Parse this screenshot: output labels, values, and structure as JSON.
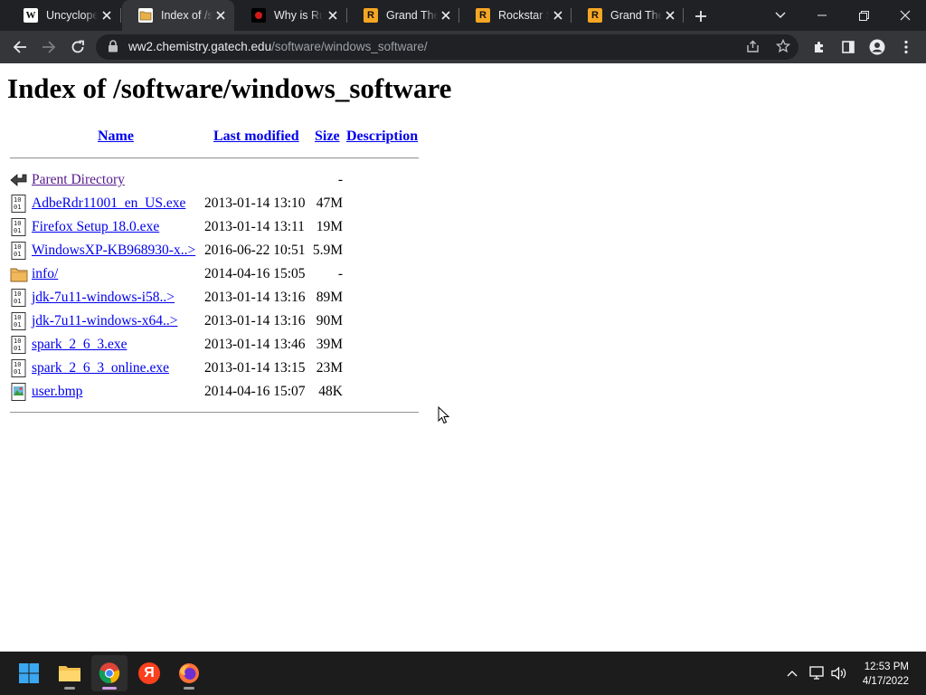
{
  "browser": {
    "tabs": [
      {
        "title": "Uncyclopedia",
        "favicon": "wikipedia-icon",
        "active": false
      },
      {
        "title": "Index of /software/windows_software",
        "favicon": "folder-icon",
        "active": true
      },
      {
        "title": "Why is Rust",
        "favicon": "video-icon",
        "active": false
      },
      {
        "title": "Grand Theft Auto",
        "favicon": "rockstar-icon",
        "active": false
      },
      {
        "title": "Rockstar Store",
        "favicon": "rockstar-icon",
        "active": false
      },
      {
        "title": "Grand Theft Auto",
        "favicon": "rockstar-icon",
        "active": false
      }
    ],
    "address": {
      "host": "ww2.chemistry.gatech.edu",
      "path": "/software/windows_software/"
    }
  },
  "page": {
    "title": "Index of /software/windows_software",
    "columns": {
      "name": "Name",
      "modified": "Last modified",
      "size": "Size",
      "description": "Description"
    },
    "entries": [
      {
        "name": "Parent Directory",
        "modified": "",
        "size": "-",
        "icon": "back-arrow-icon",
        "visited": true
      },
      {
        "name": "AdbeRdr11001_en_US.exe",
        "modified": "2013-01-14 13:10",
        "size": "47M",
        "icon": "binary-file-icon"
      },
      {
        "name": "Firefox Setup 18.0.exe",
        "modified": "2013-01-14 13:11",
        "size": "19M",
        "icon": "binary-file-icon"
      },
      {
        "name": "WindowsXP-KB968930-x..>",
        "modified": "2016-06-22 10:51",
        "size": "5.9M",
        "icon": "binary-file-icon"
      },
      {
        "name": "info/",
        "modified": "2014-04-16 15:05",
        "size": "-",
        "icon": "folder-icon"
      },
      {
        "name": "jdk-7u11-windows-i58..>",
        "modified": "2013-01-14 13:16",
        "size": "89M",
        "icon": "binary-file-icon"
      },
      {
        "name": "jdk-7u11-windows-x64..>",
        "modified": "2013-01-14 13:16",
        "size": "90M",
        "icon": "binary-file-icon"
      },
      {
        "name": "spark_2_6_3.exe",
        "modified": "2013-01-14 13:46",
        "size": "39M",
        "icon": "binary-file-icon"
      },
      {
        "name": "spark_2_6_3_online.exe",
        "modified": "2013-01-14 13:15",
        "size": "23M",
        "icon": "binary-file-icon"
      },
      {
        "name": "user.bmp",
        "modified": "2014-04-16 15:07",
        "size": "48K",
        "icon": "image-file-icon"
      }
    ]
  },
  "taskbar": {
    "apps": [
      "start-icon",
      "file-explorer-icon",
      "chrome-icon",
      "yandex-icon",
      "firefox-icon"
    ],
    "yandex_glyph": "Я",
    "time": "12:53 PM",
    "date": "4/17/2022"
  }
}
